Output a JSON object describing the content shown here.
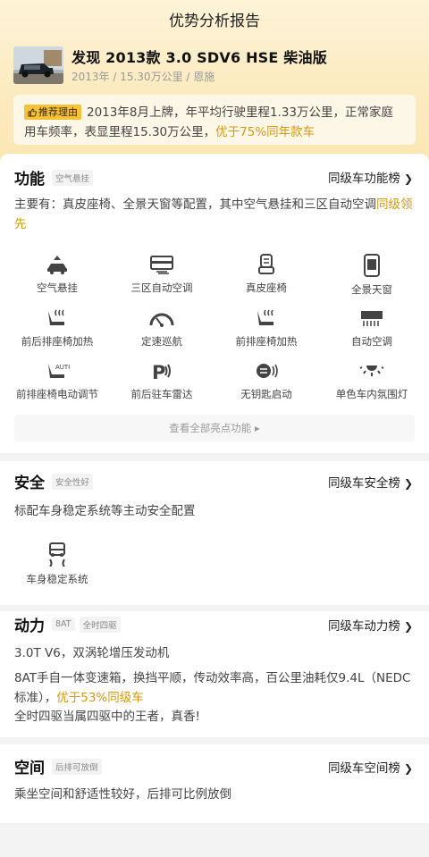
{
  "page": {
    "title": "优势分析报告"
  },
  "car": {
    "title": "发现 2013款 3.0 SDV6 HSE 柴油版",
    "meta": "2013年 / 15.30万公里 / 恩施"
  },
  "reason": {
    "tag": "推荐理由",
    "text": "2013年8月上牌，年平均行驶里程1.33万公里，正常家庭用车频率，表显里程15.30万公里，",
    "highlight": "优于75%同年款车"
  },
  "function": {
    "title": "功能",
    "tag": "空气悬挂",
    "rank": "同级车功能榜",
    "desc": "主要有：真皮座椅、全景天窗等配置，其中空气悬挂和三区自动空调",
    "desc_highlight": "同级领先",
    "features": [
      {
        "label": "空气悬挂",
        "icon": "air-suspension-icon"
      },
      {
        "label": "三区自动空调",
        "icon": "climate-control-icon"
      },
      {
        "label": "真皮座椅",
        "icon": "leather-seat-icon"
      },
      {
        "label": "全景天窗",
        "icon": "panoramic-roof-icon"
      },
      {
        "label": "前后排座椅加热",
        "icon": "seat-heating-icon"
      },
      {
        "label": "定速巡航",
        "icon": "cruise-control-icon"
      },
      {
        "label": "前排座椅加热",
        "icon": "front-seat-heating-icon"
      },
      {
        "label": "自动空调",
        "icon": "auto-ac-icon"
      },
      {
        "label": "前排座椅电动调节",
        "icon": "power-seat-icon"
      },
      {
        "label": "前后驻车雷达",
        "icon": "parking-radar-icon"
      },
      {
        "label": "无钥匙启动",
        "icon": "keyless-start-icon"
      },
      {
        "label": "单色车内氛围灯",
        "icon": "ambient-light-icon"
      }
    ],
    "view_all": "查看全部亮点功能"
  },
  "safety": {
    "title": "安全",
    "tag": "安全性好",
    "rank": "同级车安全榜",
    "desc": "标配车身稳定系统等主动安全配置",
    "features": [
      {
        "label": "车身稳定系统",
        "icon": "stability-control-icon"
      }
    ]
  },
  "power": {
    "title": "动力",
    "tags": [
      "8AT",
      "全时四驱"
    ],
    "rank": "同级车动力榜",
    "desc1": "3.0T V6，双涡轮增压发动机",
    "desc2": "8AT手自一体变速箱，换挡平顺，传动效率高，百公里油耗仅9.4L（NEDC标准），",
    "desc2_highlight": "优于53%同级车",
    "desc3": "全时四驱当属四驱中的王者，真香!"
  },
  "space": {
    "title": "空间",
    "tag": "后排可放倒",
    "rank": "同级车空间榜",
    "desc": "乘坐空间和舒适性较好，后排可比例放倒"
  },
  "colors": {
    "accent": "#d39a10",
    "tag_bg": "#f5c23a",
    "header_bg": "#fcebc0"
  }
}
